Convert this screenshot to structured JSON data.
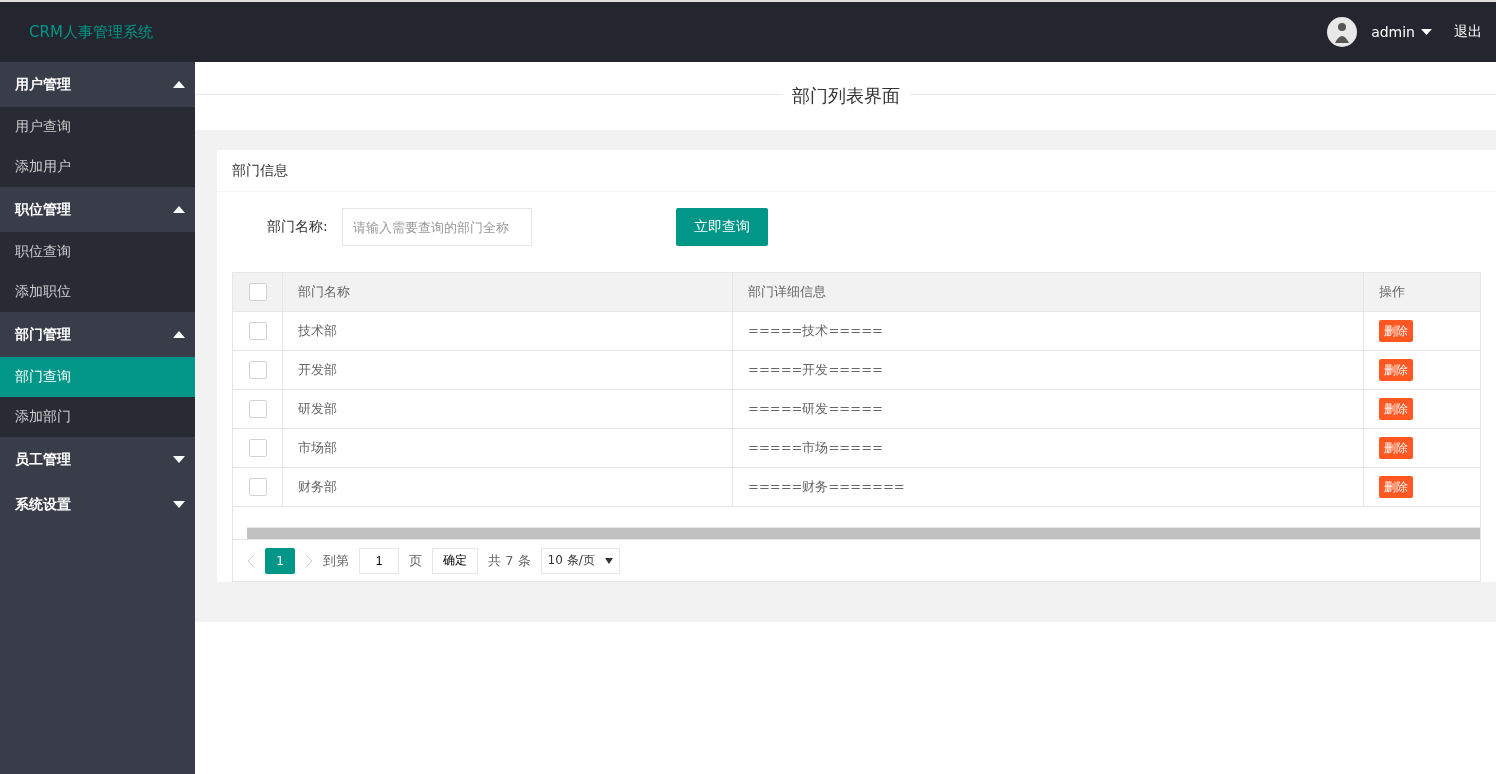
{
  "header": {
    "logo": "CRM人事管理系统",
    "user": "admin",
    "logout": "退出"
  },
  "sidebar": {
    "groups": [
      {
        "label": "用户管理",
        "expanded": true,
        "items": [
          {
            "label": "用户查询",
            "selected": false
          },
          {
            "label": "添加用户",
            "selected": false
          }
        ]
      },
      {
        "label": "职位管理",
        "expanded": true,
        "items": [
          {
            "label": "职位查询",
            "selected": false
          },
          {
            "label": "添加职位",
            "selected": false
          }
        ]
      },
      {
        "label": "部门管理",
        "expanded": true,
        "items": [
          {
            "label": "部门查询",
            "selected": true
          },
          {
            "label": "添加部门",
            "selected": false
          }
        ]
      },
      {
        "label": "员工管理",
        "expanded": false
      },
      {
        "label": "系统设置",
        "expanded": false
      }
    ]
  },
  "page_title": "部门列表界面",
  "card": {
    "title": "部门信息",
    "search": {
      "label": "部门名称:",
      "placeholder": "请输入需要查询的部门全称",
      "button": "立即查询"
    }
  },
  "table": {
    "all_checked": false,
    "columns": [
      "部门名称",
      "部门详细信息",
      "操作"
    ],
    "rows": [
      {
        "checked": false,
        "name": "技术部",
        "detail": "=====技术=====",
        "action": "删除"
      },
      {
        "checked": false,
        "name": "开发部",
        "detail": "=====开发=====",
        "action": "删除"
      },
      {
        "checked": false,
        "name": "研发部",
        "detail": "=====研发=====",
        "action": "删除"
      },
      {
        "checked": false,
        "name": "市场部",
        "detail": "=====市场=====",
        "action": "删除"
      },
      {
        "checked": false,
        "name": "财务部",
        "detail": "=====财务=======",
        "action": "删除"
      }
    ]
  },
  "pager": {
    "pages": [
      {
        "label": "1",
        "selected": true
      }
    ],
    "goto_label": "到第",
    "goto_value": "1",
    "page_unit": "页",
    "confirm": "确定",
    "total": "共 7 条",
    "page_size": "10 条/页"
  }
}
